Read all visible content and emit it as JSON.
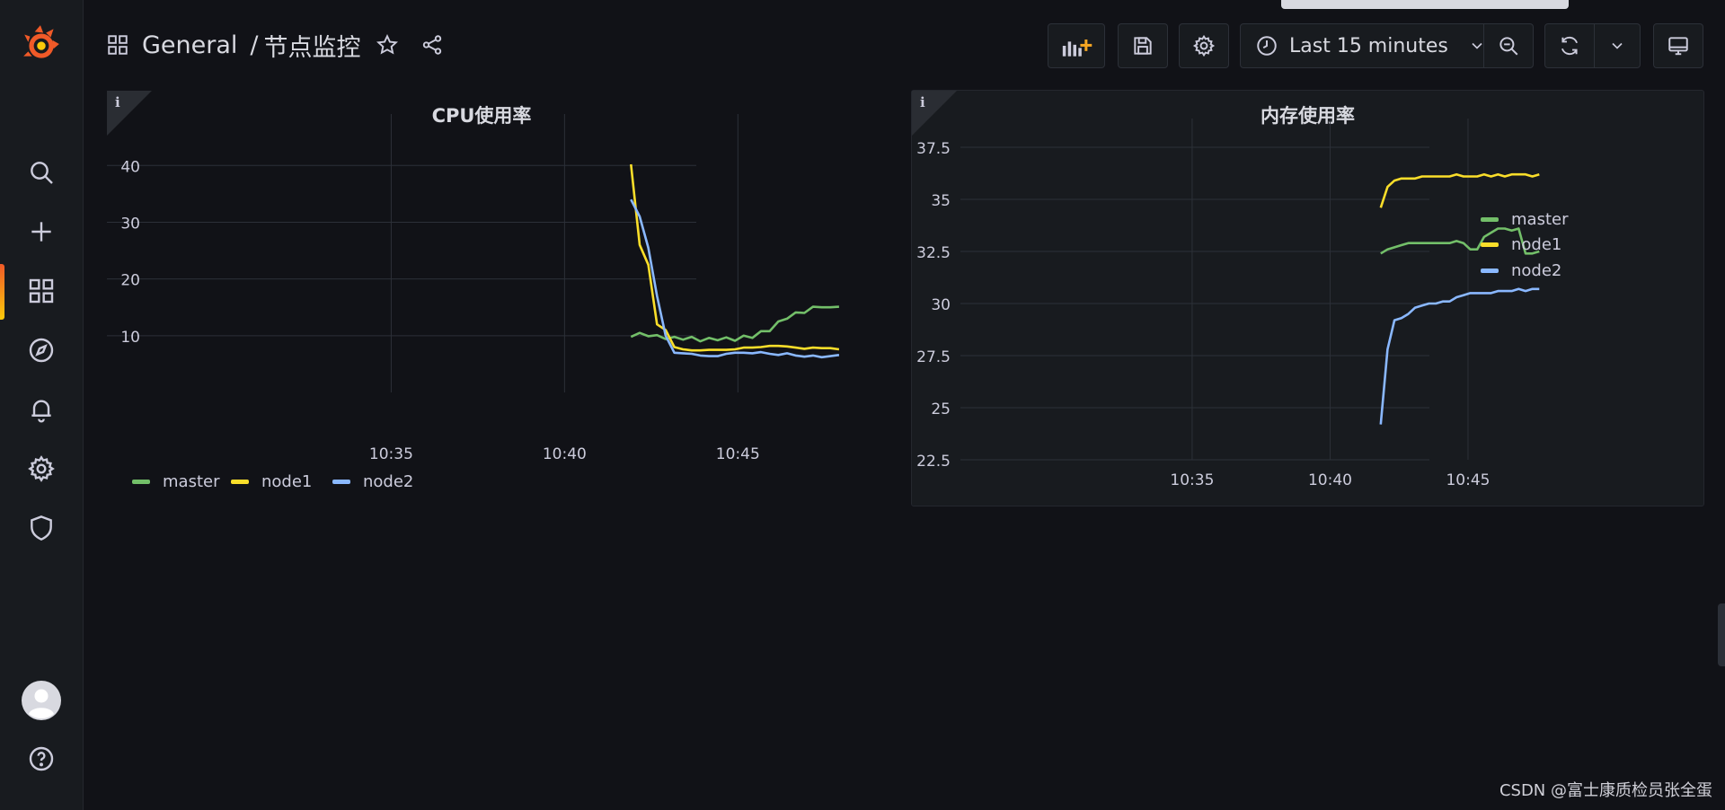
{
  "breadcrumb": {
    "folder": "General",
    "separator": "/",
    "dashboard": "节点监控"
  },
  "toolbar": {
    "time_range": "Last 15 minutes"
  },
  "colors": {
    "master": "#73bf69",
    "node1": "#fade2a",
    "node2": "#8ab8ff",
    "accent": "#f05a28"
  },
  "panels": [
    {
      "title": "CPU使用率",
      "legend_position": "bottom",
      "info_icon": "i",
      "chart_data": {
        "type": "line",
        "title": "CPU使用率",
        "x_ticks": [
          "10:35",
          "10:40",
          "10:45"
        ],
        "y_ticks": [
          10,
          20,
          30,
          40
        ],
        "xlim_minutes": [
          -13.2,
          3.8
        ],
        "ylim": [
          0,
          44
        ],
        "grid": true,
        "series": [
          {
            "name": "master",
            "color": "#73bf69",
            "x": [
              "10:41:55",
              "10:42:10",
              "10:42:25",
              "10:42:40",
              "10:42:55",
              "10:43:10",
              "10:43:25",
              "10:43:40",
              "10:43:55",
              "10:44:10",
              "10:44:25",
              "10:44:40",
              "10:44:55",
              "10:45:10",
              "10:45:25",
              "10:45:40",
              "10:45:55",
              "10:46:10",
              "10:46:25",
              "10:46:40",
              "10:46:55",
              "10:47:10",
              "10:47:25",
              "10:47:40",
              "10:47:55"
            ],
            "values": [
              9.8,
              10.5,
              9.9,
              10.1,
              9.4,
              9.8,
              9.3,
              9.8,
              9.0,
              9.6,
              9.2,
              9.7,
              9.1,
              10.0,
              9.6,
              10.8,
              10.8,
              12.5,
              13.0,
              14.1,
              14.0,
              15.1,
              15.0,
              15.0,
              15.1
            ]
          },
          {
            "name": "node1",
            "color": "#fade2a",
            "x": [
              "10:41:55",
              "10:42:10",
              "10:42:25",
              "10:42:40",
              "10:42:55",
              "10:43:10",
              "10:43:25",
              "10:43:40",
              "10:43:55",
              "10:44:10",
              "10:44:25",
              "10:44:40",
              "10:44:55",
              "10:45:10",
              "10:45:25",
              "10:45:40",
              "10:45:55",
              "10:46:10",
              "10:46:25",
              "10:46:40",
              "10:46:55",
              "10:47:10",
              "10:47:25",
              "10:47:40",
              "10:47:55"
            ],
            "values": [
              40.2,
              26.0,
              22.5,
              12.0,
              11.0,
              8.0,
              7.6,
              7.4,
              7.4,
              7.5,
              7.5,
              7.5,
              7.6,
              7.9,
              7.9,
              8.0,
              8.2,
              8.2,
              8.1,
              7.9,
              7.7,
              7.9,
              7.8,
              7.8,
              7.6
            ]
          },
          {
            "name": "node2",
            "color": "#8ab8ff",
            "x": [
              "10:41:55",
              "10:42:10",
              "10:42:25",
              "10:42:40",
              "10:42:55",
              "10:43:10",
              "10:43:25",
              "10:43:40",
              "10:43:55",
              "10:44:10",
              "10:44:25",
              "10:44:40",
              "10:44:55",
              "10:45:10",
              "10:45:25",
              "10:45:40",
              "10:45:55",
              "10:46:10",
              "10:46:25",
              "10:46:40",
              "10:46:55",
              "10:47:10",
              "10:47:25",
              "10:47:40",
              "10:47:55"
            ],
            "values": [
              34.0,
              31.0,
              25.5,
              17.0,
              10.0,
              7.0,
              6.9,
              6.8,
              6.5,
              6.4,
              6.4,
              6.8,
              7.0,
              7.0,
              6.9,
              7.1,
              6.8,
              6.6,
              6.9,
              6.5,
              6.3,
              6.5,
              6.2,
              6.4,
              6.6
            ]
          }
        ]
      }
    },
    {
      "title": "内存使用率",
      "legend_position": "right",
      "info_icon": "i",
      "chart_data": {
        "type": "line",
        "title": "内存使用率",
        "x_ticks": [
          "10:35",
          "10:40",
          "10:45"
        ],
        "y_ticks": [
          22.5,
          25,
          27.5,
          30,
          32.5,
          35,
          37.5
        ],
        "xlim_minutes": [
          -13.4,
          3.6
        ],
        "ylim": [
          22.5,
          37.5
        ],
        "grid": true,
        "series": [
          {
            "name": "master",
            "color": "#73bf69",
            "x": [
              "10:41:50",
              "10:42:05",
              "10:42:20",
              "10:42:35",
              "10:42:50",
              "10:43:05",
              "10:43:20",
              "10:43:35",
              "10:43:50",
              "10:44:05",
              "10:44:20",
              "10:44:35",
              "10:44:50",
              "10:45:05",
              "10:45:20",
              "10:45:35",
              "10:45:50",
              "10:46:05",
              "10:46:20",
              "10:46:35",
              "10:46:50",
              "10:47:05",
              "10:47:20",
              "10:47:35"
            ],
            "values": [
              32.4,
              32.6,
              32.7,
              32.8,
              32.9,
              32.9,
              32.9,
              32.9,
              32.9,
              32.9,
              32.9,
              33.0,
              32.9,
              32.6,
              32.6,
              33.2,
              33.4,
              33.6,
              33.6,
              33.5,
              33.6,
              32.4,
              32.4,
              32.5
            ]
          },
          {
            "name": "node1",
            "color": "#fade2a",
            "x": [
              "10:41:50",
              "10:42:05",
              "10:42:20",
              "10:42:35",
              "10:42:50",
              "10:43:05",
              "10:43:20",
              "10:43:35",
              "10:43:50",
              "10:44:05",
              "10:44:20",
              "10:44:35",
              "10:44:50",
              "10:45:05",
              "10:45:20",
              "10:45:35",
              "10:45:50",
              "10:46:05",
              "10:46:20",
              "10:46:35",
              "10:46:50",
              "10:47:05",
              "10:47:20",
              "10:47:35"
            ],
            "values": [
              34.6,
              35.6,
              35.9,
              36.0,
              36.0,
              36.0,
              36.1,
              36.1,
              36.1,
              36.1,
              36.1,
              36.2,
              36.1,
              36.1,
              36.1,
              36.2,
              36.1,
              36.2,
              36.1,
              36.2,
              36.2,
              36.2,
              36.1,
              36.2
            ]
          },
          {
            "name": "node2",
            "color": "#8ab8ff",
            "x": [
              "10:41:50",
              "10:42:05",
              "10:42:20",
              "10:42:35",
              "10:42:50",
              "10:43:05",
              "10:43:20",
              "10:43:35",
              "10:43:50",
              "10:44:05",
              "10:44:20",
              "10:44:35",
              "10:44:50",
              "10:45:05",
              "10:45:20",
              "10:45:35",
              "10:45:50",
              "10:46:05",
              "10:46:20",
              "10:46:35",
              "10:46:50",
              "10:47:05",
              "10:47:20",
              "10:47:35"
            ],
            "values": [
              24.2,
              27.8,
              29.2,
              29.3,
              29.5,
              29.8,
              29.9,
              30.0,
              30.0,
              30.1,
              30.1,
              30.3,
              30.4,
              30.5,
              30.5,
              30.5,
              30.5,
              30.6,
              30.6,
              30.6,
              30.7,
              30.6,
              30.7,
              30.7
            ]
          }
        ]
      }
    }
  ],
  "watermark": "CSDN @富士康质检员张全蛋"
}
